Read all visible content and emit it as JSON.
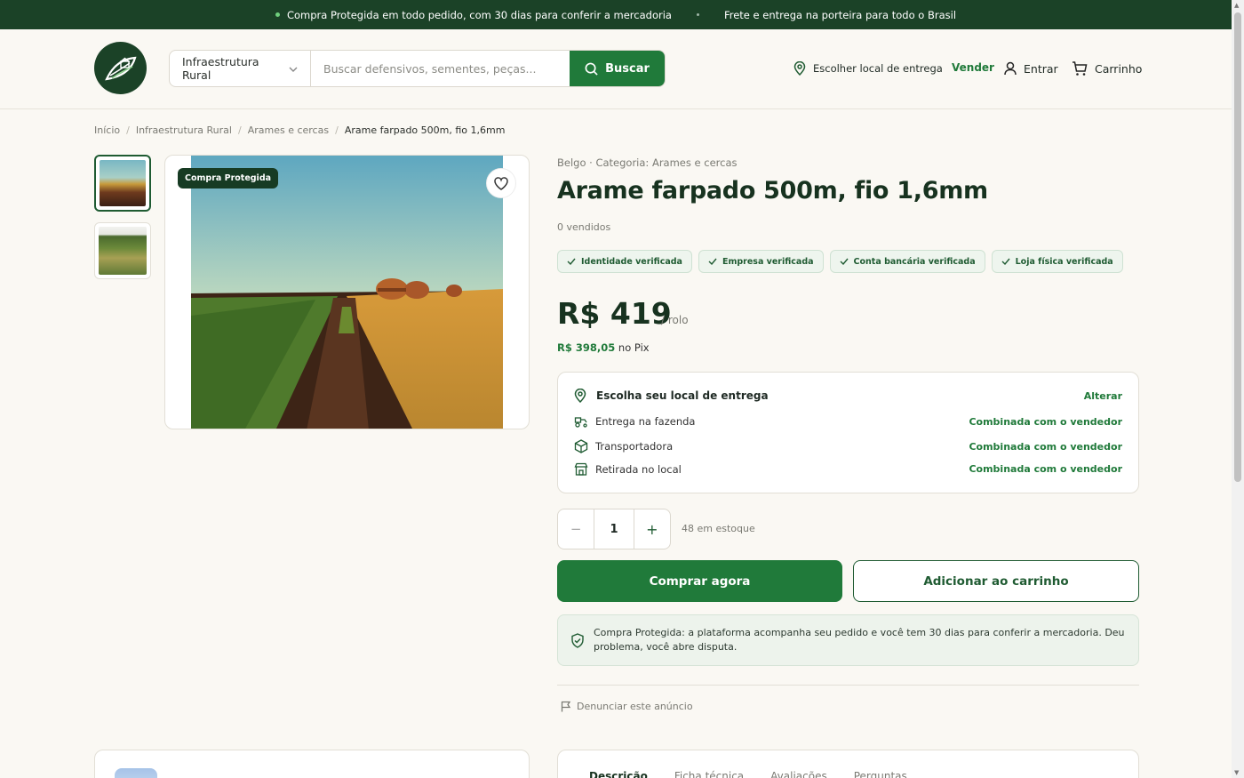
{
  "topbar": {
    "msg1": "Compra Protegida em todo pedido, com 30 dias para conferir a mercadoria",
    "msg2": "Frete e entrega na porteira para todo o Brasil"
  },
  "header": {
    "category": "Infraestrutura Rural",
    "search_placeholder": "Buscar defensivos, sementes, peças...",
    "search_button": "Buscar",
    "location": "Escolher local de entrega",
    "sell": "Vender",
    "login": "Entrar",
    "cart": "Carrinho"
  },
  "breadcrumb": [
    "Início",
    "Infraestrutura Rural",
    "Arames e cercas",
    "Arame farpado 500m, fio 1,6mm"
  ],
  "gallery": {
    "badge": "Compra Protegida"
  },
  "product": {
    "brandline": "Belgo · Categoria: Arames e cercas",
    "title": "Arame farpado 500m, fio 1,6mm",
    "sold": "0 vendidos",
    "chips": [
      "Identidade verificada",
      "Empresa verificada",
      "Conta bancária verificada",
      "Loja física verificada"
    ],
    "price": "R$ 419",
    "unit": "/ rolo",
    "pix_price": "R$ 398,05",
    "pix_label": "no Pix"
  },
  "delivery": {
    "title": "Escolha seu local de entrega",
    "change": "Alterar",
    "options": [
      {
        "label": "Entrega na fazenda",
        "value": "Combinada com o vendedor"
      },
      {
        "label": "Transportadora",
        "value": "Combinada com o vendedor"
      },
      {
        "label": "Retirada no local",
        "value": "Combinada com o vendedor"
      }
    ]
  },
  "purchase": {
    "minus": "−",
    "quantity": "1",
    "plus": "+",
    "stock": "48 em estoque",
    "buy_now": "Comprar agora",
    "add_to_cart": "Adicionar ao carrinho"
  },
  "protection": {
    "text": "Compra Protegida: a plataforma acompanha seu pedido e você tem 30 dias para conferir a mercadoria. Deu problema, você abre disputa."
  },
  "report": "Denunciar este anúncio",
  "tabs": [
    "Descrição",
    "Ficha técnica",
    "Avaliações",
    "Perguntas"
  ],
  "colors": {
    "brand_dark": "#1b4227",
    "brand_green": "#207a3a",
    "background": "#faf8f3"
  }
}
